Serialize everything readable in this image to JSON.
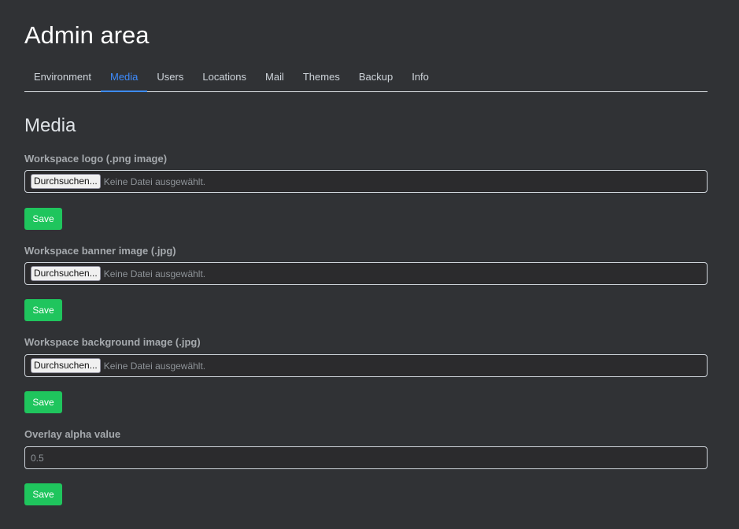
{
  "header": {
    "title": "Admin area"
  },
  "tabs": [
    {
      "label": "Environment",
      "active": false
    },
    {
      "label": "Media",
      "active": true
    },
    {
      "label": "Users",
      "active": false
    },
    {
      "label": "Locations",
      "active": false
    },
    {
      "label": "Mail",
      "active": false
    },
    {
      "label": "Themes",
      "active": false
    },
    {
      "label": "Backup",
      "active": false
    },
    {
      "label": "Info",
      "active": false
    }
  ],
  "section": {
    "title": "Media"
  },
  "fields": {
    "logo": {
      "label": "Workspace logo (.png image)",
      "button": "Durchsuchen...",
      "status": "Keine Datei ausgewählt.",
      "save": "Save"
    },
    "banner": {
      "label": "Workspace banner image (.jpg)",
      "button": "Durchsuchen...",
      "status": "Keine Datei ausgewählt.",
      "save": "Save"
    },
    "background": {
      "label": "Workspace background image (.jpg)",
      "button": "Durchsuchen...",
      "status": "Keine Datei ausgewählt.",
      "save": "Save"
    },
    "overlay": {
      "label": "Overlay alpha value",
      "value": "0.5",
      "save": "Save"
    }
  },
  "colors": {
    "background": "#303235",
    "accent": "#3d8bfd",
    "save": "#1fc55d"
  }
}
